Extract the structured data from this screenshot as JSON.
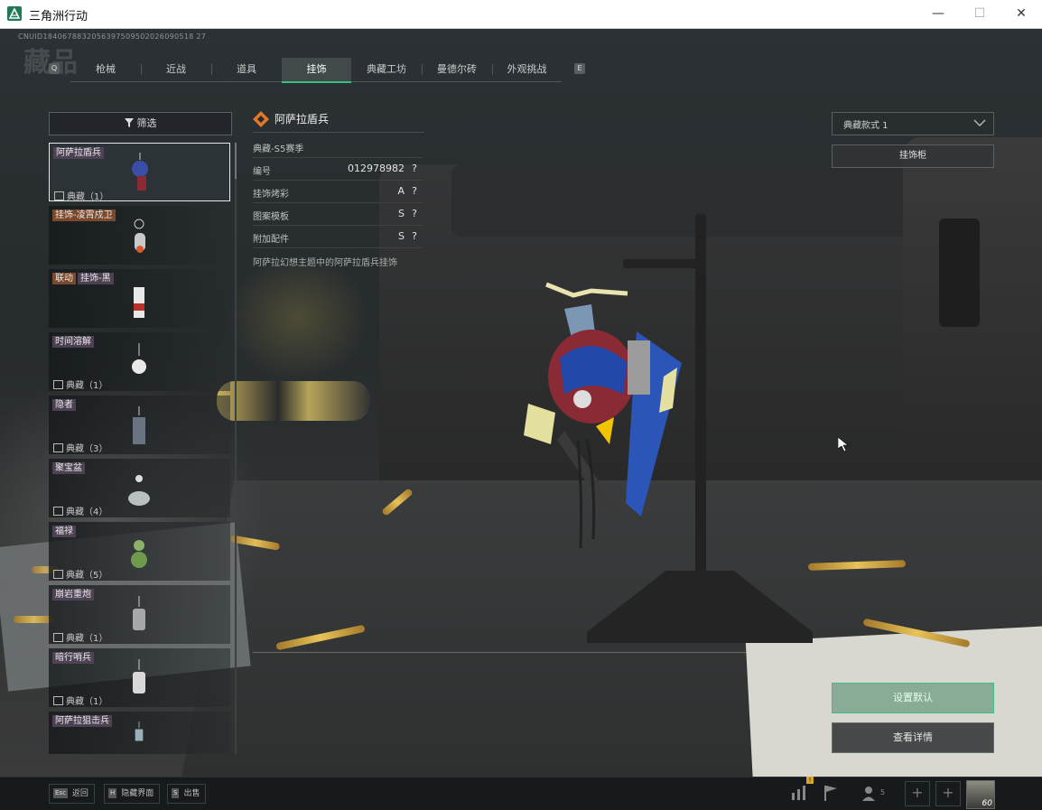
{
  "window": {
    "title": "三角洲行动",
    "minimize_glyph": "—",
    "maximize_glyph": "☐",
    "close_glyph": "✕"
  },
  "header": {
    "uid": "CNUID1840678832056397509502026090518 27",
    "faded_title": "藏品"
  },
  "tabs": {
    "prev_key": "Q",
    "next_key": "E",
    "items": [
      {
        "label": "枪械"
      },
      {
        "label": "近战"
      },
      {
        "label": "道具"
      },
      {
        "label": "挂饰",
        "active": true
      },
      {
        "label": "典藏工坊"
      },
      {
        "label": "曼德尔砖"
      },
      {
        "label": "外观挑战"
      }
    ]
  },
  "list": {
    "filter_label": "筛选",
    "items": [
      {
        "name": "阿萨拉盾兵",
        "meta": "典藏（1）",
        "selected": true
      },
      {
        "name": "挂饰-凌霄戍卫",
        "meta": "",
        "tag_color": "orange"
      },
      {
        "name": "联动",
        "name2": "挂饰-黑",
        "meta": "",
        "tag_color": "orange"
      },
      {
        "name": "时间溶解",
        "meta": "典藏（1）"
      },
      {
        "name": "隐者",
        "meta": "典藏（3）"
      },
      {
        "name": "聚宝盆",
        "meta": "典藏（4）"
      },
      {
        "name": "福禄",
        "meta": "典藏（5）"
      },
      {
        "name": "崩岩重炮",
        "meta": "典藏（1）"
      },
      {
        "name": "暗行哨兵",
        "meta": "典藏（1）"
      },
      {
        "name": "阿萨拉狙击兵",
        "meta": ""
      }
    ]
  },
  "detail": {
    "title": "阿萨拉盾兵",
    "season": "典藏-S5赛季",
    "rows": [
      {
        "label": "编号",
        "value": "012978982",
        "q": "?"
      },
      {
        "label": "挂饰烤彩",
        "value": "A",
        "q": "?"
      },
      {
        "label": "图案模板",
        "value": "S",
        "q": "?"
      },
      {
        "label": "附加配件",
        "value": "S",
        "q": "?"
      }
    ],
    "description": "阿萨拉幻想主题中的阿萨拉盾兵挂饰"
  },
  "right": {
    "style_select": "典藏款式 1",
    "cabinet_button": "挂饰柜",
    "set_default_button": "设置默认",
    "view_detail_button": "查看详情"
  },
  "bottom": {
    "keys": [
      {
        "key": "Esc",
        "label": "返回"
      },
      {
        "key": "H",
        "label": "隐藏界面"
      },
      {
        "key": "S",
        "label": "出售"
      }
    ],
    "badge": "!",
    "friends_count": "5",
    "slot_glyph": "+",
    "level": "60"
  },
  "colors": {
    "accent_green": "#39c081",
    "tag_purple": "#55465a",
    "tag_orange": "#8c502d"
  }
}
